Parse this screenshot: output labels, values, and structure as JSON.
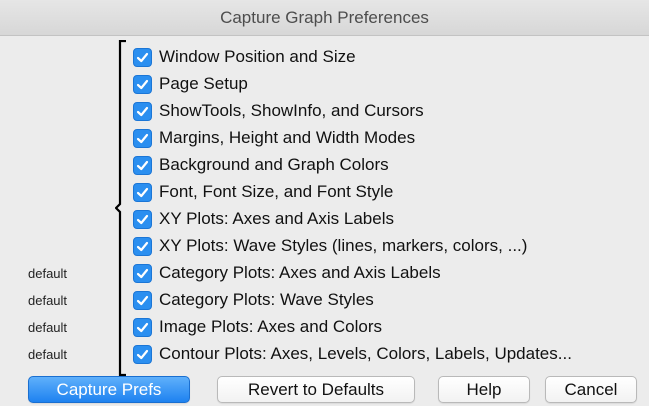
{
  "window": {
    "title": "Capture Graph Preferences"
  },
  "colors": {
    "accent": "#2b8ff0",
    "background": "#ececec"
  },
  "items": [
    {
      "label": "Window Position and Size",
      "checked": true,
      "note": ""
    },
    {
      "label": "Page Setup",
      "checked": true,
      "note": ""
    },
    {
      "label": "ShowTools, ShowInfo, and Cursors",
      "checked": true,
      "note": ""
    },
    {
      "label": "Margins, Height and Width Modes",
      "checked": true,
      "note": ""
    },
    {
      "label": "Background and Graph Colors",
      "checked": true,
      "note": ""
    },
    {
      "label": "Font, Font Size, and Font Style",
      "checked": true,
      "note": ""
    },
    {
      "label": "XY Plots: Axes and Axis Labels",
      "checked": true,
      "note": ""
    },
    {
      "label": "XY Plots: Wave Styles (lines, markers, colors, ...)",
      "checked": true,
      "note": ""
    },
    {
      "label": "Category Plots: Axes and Axis Labels",
      "checked": true,
      "note": "default"
    },
    {
      "label": "Category Plots: Wave Styles",
      "checked": true,
      "note": "default"
    },
    {
      "label": "Image Plots: Axes and Colors",
      "checked": true,
      "note": "default"
    },
    {
      "label": "Contour Plots: Axes, Levels, Colors, Labels, Updates...",
      "checked": true,
      "note": "default"
    }
  ],
  "buttons": {
    "capture": "Capture Prefs",
    "revert": "Revert to Defaults",
    "help": "Help",
    "cancel": "Cancel"
  }
}
